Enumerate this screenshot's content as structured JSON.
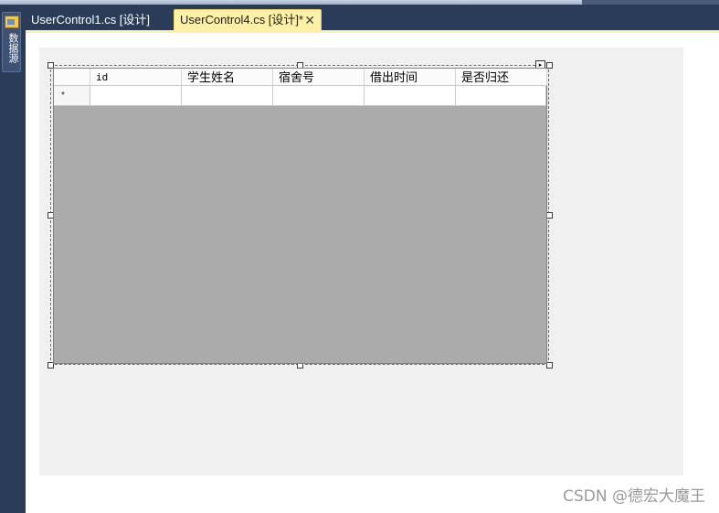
{
  "side_toolbar": {
    "label": "数据源",
    "icon": "toolbox-icon"
  },
  "tabs": [
    {
      "label": "UserControl1.cs [设计]",
      "active": false
    },
    {
      "label": "UserControl4.cs [设计]*",
      "active": true,
      "close_glyph": "✕"
    }
  ],
  "grid": {
    "columns": [
      "id",
      "学生姓名",
      "宿舍号",
      "借出时间",
      "是否归还"
    ],
    "new_row_marker": "*",
    "smart_tag_glyph": "▸",
    "background_color": "#ababab"
  },
  "watermark": "CSDN @德宏大魔王"
}
